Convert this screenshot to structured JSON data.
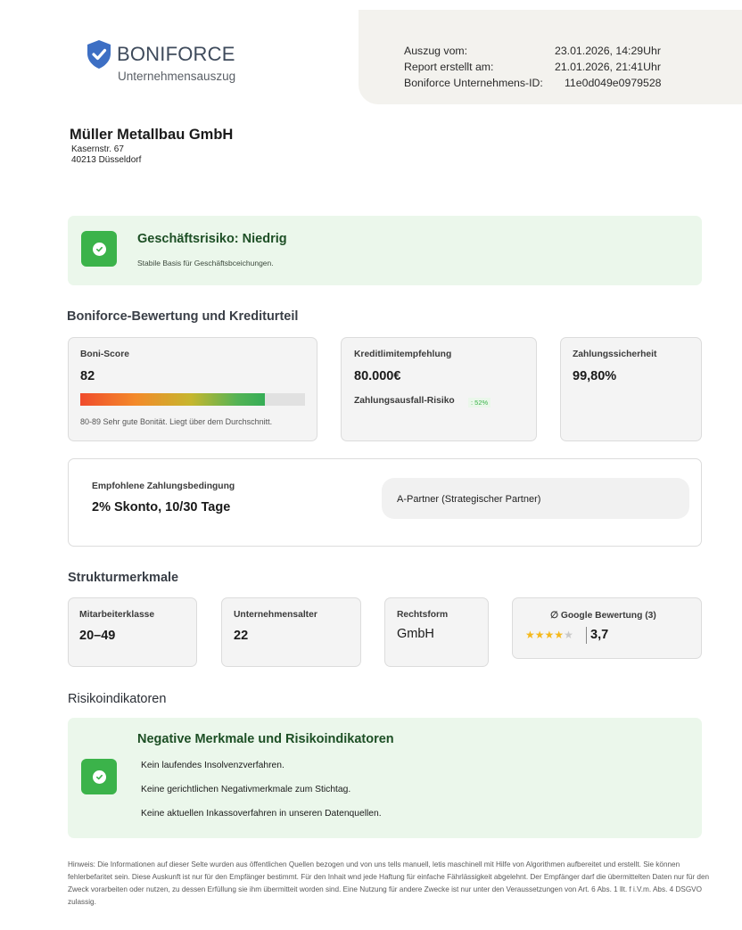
{
  "header": {
    "brand": "BONIFORCE",
    "subtitle": "Unternehmensauszug",
    "meta": [
      {
        "label": "Auszug vom:",
        "value": "23.01.2026, 14:29Uhr"
      },
      {
        "label": "Report erstellt am:",
        "value": "21.01.2026, 21:41Uhr"
      },
      {
        "label": "Boniforce Unternehmens-ID:",
        "value": "11e0d049e0979528"
      }
    ]
  },
  "company": {
    "name": "Müller Metallbau GmbH",
    "street": "Kasernstr. 67",
    "city": "40213 Düsseldorf"
  },
  "risk": {
    "title": "Geschäftsrisiko: Niedrig",
    "subtitle": "Stabile Basis für Geschäftsbceichungen."
  },
  "rating_section": {
    "heading": "Boniforce-Bewertung und Krediturteil",
    "boni_score": {
      "label": "Boni-Score",
      "value": "82",
      "bar_fill_percent": 82,
      "note": "80-89 Sehr gute Bonität. Liegt über dem Durchschnitt."
    },
    "credit_limit": {
      "label": "Kreditlimitempfehlung",
      "value": "80.000€",
      "risk_label": "Zahlungsausfall-Risiko",
      "risk_value": ": 52%"
    },
    "payment_security": {
      "label": "Zahlungssicherheit",
      "value": "99,80%"
    },
    "payment_terms": {
      "label": "Empfohlene Zahlungsbedingung",
      "value": "2% Skonto, 10/30 Tage",
      "partner": "A-Partner (Strategischer Partner)"
    }
  },
  "structure": {
    "heading": "Strukturmerkmale",
    "employees": {
      "label": "Mitarbeiterklasse",
      "value": "20–49"
    },
    "age": {
      "label": "Unternehmensalter",
      "value": "22"
    },
    "legal_form": {
      "label": "Rechtsform",
      "value": "GmbH"
    },
    "google": {
      "label": "∅ Google Bewertung (3)",
      "value": "3,7",
      "stars_filled": 4,
      "stars_total": 5
    }
  },
  "risk_indicators": {
    "heading": "Risikoindikatoren",
    "title": "Negative Merkmale und Risikoindikatoren",
    "items": [
      "Kein laufendes Insolvenzverfahren.",
      "Keine gerichtlichen Negativmerkmale zum Stichtag.",
      "Keine aktuellen Inkassoverfahren in unseren Datenquellen."
    ]
  },
  "disclaimer": "Hinweis: Die Informationen auf dieser Selte wurden aus öffentlichen Quellen bezogen und von uns tells manuell, letis maschinell mit Hilfe von Algorithmen aufbereitet und erstellt. Sie können fehlerbefaritet sein. Diese Auskunft ist nur für den Empfänger bestimmt. Für den Inhait wnd jede Haftung für einfache Fährlässigkeit abgelehnt. Der Empfänger darf die übermittelten Daten nur für den Zweck vorarbeiten oder nutzen, zu dessen Erfüllung sie ihm übermitteit worden sind. Eine Nutzung für andere Zwecke ist nur unter den Veraussetzungen von Art. 6 Abs. 1 llt. f i.V.m. Abs. 4 DSGVO zulassig.",
  "colors": {
    "brand_blue": "#3d6fc4",
    "success_green": "#3bb34a",
    "success_bg": "#ebf7eb",
    "title_green": "#1d4f25",
    "star": "#f5b81b"
  },
  "icons": [
    "shield-check-icon",
    "check-circle-icon",
    "star-icon"
  ]
}
